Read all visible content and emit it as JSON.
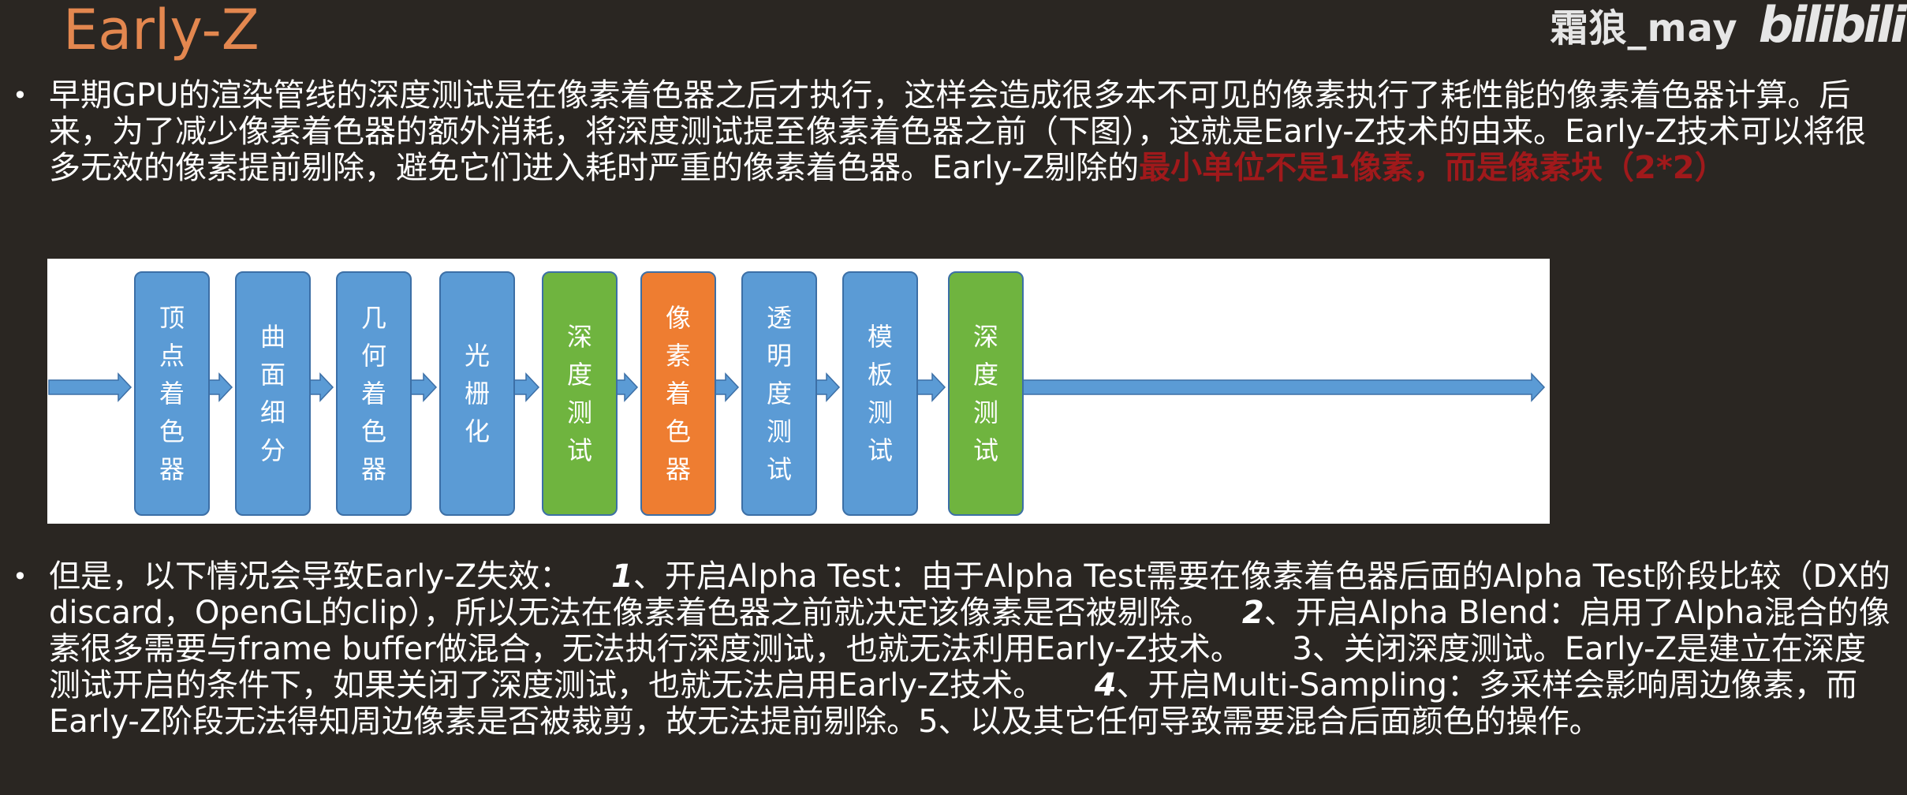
{
  "slide": {
    "title": "Early-Z",
    "watermark_text": "霜狼_may",
    "watermark_logo": "bilibili"
  },
  "paragraph1": {
    "text": "早期GPU的渲染管线的深度测试是在像素着色器之后才执行，这样会造成很多本不可见的像素执行了耗性能的像素着色器计算。后来，为了减少像素着色器的额外消耗，将深度测试提至像素着色器之前（下图），这就是Early-Z技术的由来。Early-Z技术可以将很多无效的像素提前剔除，避免它们进入耗时严重的像素着色器。Early-Z剔除的",
    "highlight": "最小单位不是1像素，而是像素块（2*2）"
  },
  "pipeline": {
    "stages": [
      {
        "label": "顶点着色器",
        "color": "#5b9bd5"
      },
      {
        "label": "曲面细分",
        "color": "#5b9bd5"
      },
      {
        "label": "几何着色器",
        "color": "#5b9bd5"
      },
      {
        "label": "光栅化",
        "color": "#5b9bd5"
      },
      {
        "label": "深度测试",
        "color": "#6fb43f"
      },
      {
        "label": "像素着色器",
        "color": "#ee7d31"
      },
      {
        "label": "透明度测试",
        "color": "#5b9bd5"
      },
      {
        "label": "模板测试",
        "color": "#5b9bd5"
      },
      {
        "label": "深度测试",
        "color": "#6fb43f"
      }
    ],
    "arrow_color": "#5b9bd5"
  },
  "paragraph2": {
    "intro": "但是，以下情况会导致Early-Z失效：",
    "n1": "1",
    "t1": "、开启Alpha Test：由于Alpha Test需要在像素着色器后面的Alpha Test阶段比较（DX的discard，OpenGL的clip），所以无法在像素着色器之前就决定该像素是否被剔除。",
    "n2": "2",
    "t2": "、开启Alpha Blend：启用了Alpha混合的像素很多需要与frame buffer做混合，无法执行深度测试，也就无法利用Early-Z技术。",
    "n3": "3",
    "t3": "、关闭深度测试。Early-Z是建立在深度测试开启的条件下，如果关闭了深度测试，也就无法启用Early-Z技术。",
    "n4": "4",
    "t4": "、开启Multi-Sampling：多采样会影响周边像素，而Early-Z阶段无法得知周边像素是否被裁剪，故无法提前剔除。5、以及其它任何导致需要混合后面颜色的操作。"
  }
}
